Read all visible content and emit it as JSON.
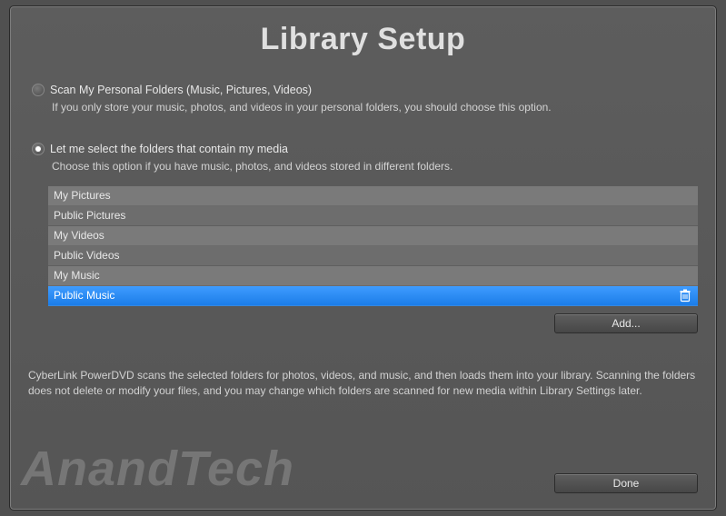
{
  "title": "Library Setup",
  "option_personal": {
    "label": "Scan My Personal Folders (Music, Pictures, Videos)",
    "desc": "If you only store your music, photos, and videos in your personal folders, you should choose this option.",
    "selected": false
  },
  "option_select": {
    "label": "Let me select the folders that contain my media",
    "desc": "Choose this option if you have music, photos, and videos stored in different folders.",
    "selected": true
  },
  "folders": [
    {
      "name": "My Pictures",
      "selected": false
    },
    {
      "name": "Public Pictures",
      "selected": false
    },
    {
      "name": "My Videos",
      "selected": false
    },
    {
      "name": "Public Videos",
      "selected": false
    },
    {
      "name": "My Music",
      "selected": false
    },
    {
      "name": "Public Music",
      "selected": true
    }
  ],
  "buttons": {
    "add": "Add...",
    "done": "Done"
  },
  "info": "CyberLink PowerDVD scans the selected folders for photos, videos, and music, and then loads them into your library. Scanning the folders does not delete or modify your files, and you may change which folders are scanned for new media within Library Settings later.",
  "watermark": "AnandTech"
}
